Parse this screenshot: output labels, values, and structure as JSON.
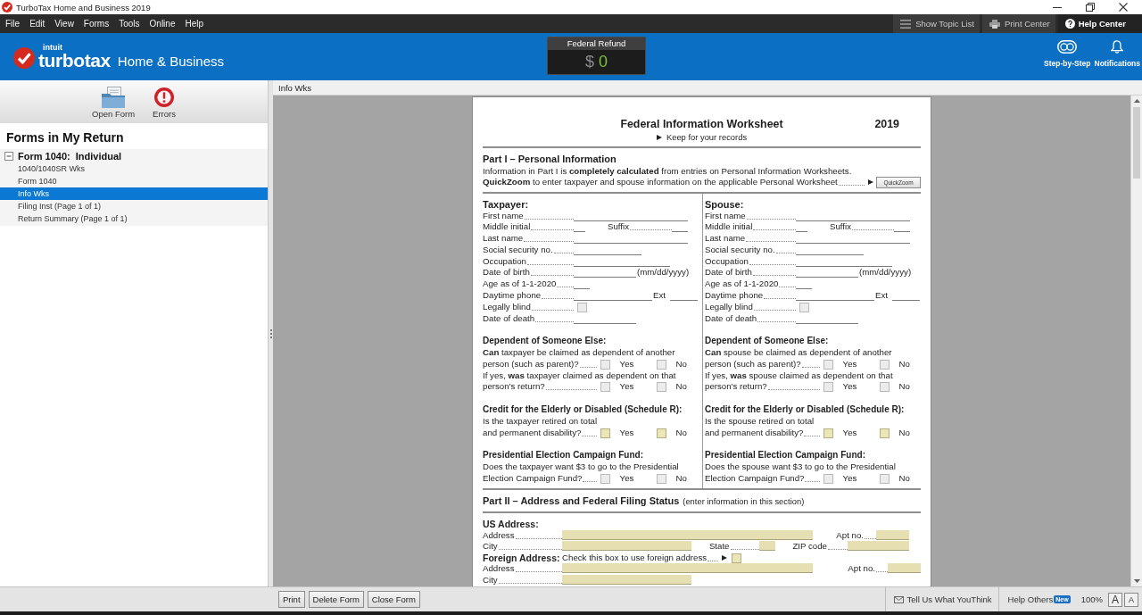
{
  "window": {
    "title": "TurboTax Home and Business 2019"
  },
  "menu": [
    "File",
    "Edit",
    "View",
    "Forms",
    "Tools",
    "Online",
    "Help"
  ],
  "toolbar_buttons": [
    {
      "label": "Show Topic List",
      "kind": "list"
    },
    {
      "label": "Print Center",
      "kind": "print"
    },
    {
      "label": "Help Center",
      "kind": "help"
    }
  ],
  "header": {
    "company": "intuit",
    "brand": "turbotax",
    "product": "Home & Business",
    "refund": {
      "label": "Federal Refund",
      "currency": "$",
      "amount": "0"
    },
    "actions": [
      {
        "label": "Step-by-Step",
        "kind": "steps"
      },
      {
        "label": "Notifications",
        "kind": "bell"
      }
    ]
  },
  "sidebar": {
    "tools": [
      {
        "label": "Open Form",
        "kind": "open"
      },
      {
        "label": "Errors",
        "kind": "errors"
      }
    ],
    "title": "Forms in My Return",
    "tree": [
      {
        "label": "Form 1040:  Individual",
        "expanded": true,
        "selected": false,
        "children": [
          {
            "label": "1040/1040SR Wks",
            "selected": false
          },
          {
            "label": "Form 1040",
            "selected": false
          },
          {
            "label": "Info Wks",
            "selected": true
          },
          {
            "label": "Filing Inst (Page 1 of 1)",
            "selected": false
          },
          {
            "label": "Return Summary (Page 1 of 1)",
            "selected": false
          }
        ]
      }
    ]
  },
  "document_tab": {
    "label": "Info Wks"
  },
  "form": {
    "title": "Federal Information Worksheet",
    "year": "2019",
    "subtitle": "Keep for your records",
    "part1": {
      "heading": "Part I – Personal Information",
      "intro": "Information in Part I is **completely calculated** from entries on Personal Information Worksheets.",
      "quickzoom_text": "**QuickZoom** to enter taxpayer and spouse information on the applicable Personal Worksheet",
      "quickzoom_button": "QuickZoom",
      "columns": [
        {
          "heading": "Taxpayer:",
          "fields": [
            {
              "kind": "name",
              "label": "First name"
            },
            {
              "kind": "initial",
              "label": "Middle initial",
              "extra_label": "Suffix"
            },
            {
              "kind": "name",
              "label": "Last name"
            },
            {
              "kind": "ssn",
              "label": "Social security no."
            },
            {
              "kind": "occupation",
              "label": "Occupation"
            },
            {
              "kind": "date",
              "label": "Date of birth",
              "hint": "(mm/dd/yyyy)"
            },
            {
              "kind": "age",
              "label": "Age as of 1-1-2020"
            },
            {
              "kind": "phone",
              "label": "Daytime phone",
              "extra_label": "Ext"
            },
            {
              "kind": "checkbox",
              "label": "Legally blind",
              "checked": false,
              "editable": false
            },
            {
              "kind": "date",
              "label": "Date of death"
            }
          ],
          "sections": [
            {
              "heading": "Dependent of Someone Else:",
              "questions": [
                {
                  "lines": [
                    "**Can** taxpayer be claimed as dependent of another",
                    "person (such as parent)?"
                  ],
                  "options": [
                    {
                      "label": "Yes",
                      "checked": false,
                      "editable": false
                    },
                    {
                      "label": "No",
                      "checked": false,
                      "editable": false
                    }
                  ]
                },
                {
                  "lines": [
                    "If yes, **was** taxpayer claimed as dependent on that",
                    "person's return?"
                  ],
                  "options": [
                    {
                      "label": "Yes",
                      "checked": false,
                      "editable": false
                    },
                    {
                      "label": "No",
                      "checked": false,
                      "editable": false
                    }
                  ]
                }
              ]
            },
            {
              "heading": "Credit for the Elderly or Disabled (Schedule R):",
              "questions": [
                {
                  "lines": [
                    "Is the taxpayer retired on total",
                    "and permanent disability?"
                  ],
                  "options": [
                    {
                      "label": "Yes",
                      "checked": false,
                      "editable": true
                    },
                    {
                      "label": "No",
                      "checked": false,
                      "editable": true
                    }
                  ]
                }
              ]
            },
            {
              "heading": "Presidential Election Campaign Fund:",
              "questions": [
                {
                  "lines": [
                    "Does the taxpayer want $3 to go to the Presidential",
                    "Election Campaign Fund?"
                  ],
                  "options": [
                    {
                      "label": "Yes",
                      "checked": false,
                      "editable": false
                    },
                    {
                      "label": "No",
                      "checked": false,
                      "editable": false
                    }
                  ]
                }
              ]
            }
          ]
        },
        {
          "heading": "Spouse:",
          "fields": [
            {
              "kind": "name",
              "label": "First name"
            },
            {
              "kind": "initial",
              "label": "Middle initial",
              "extra_label": "Suffix"
            },
            {
              "kind": "name",
              "label": "Last name"
            },
            {
              "kind": "ssn",
              "label": "Social security no."
            },
            {
              "kind": "occupation",
              "label": "Occupation"
            },
            {
              "kind": "date",
              "label": "Date of birth",
              "hint": "(mm/dd/yyyy)"
            },
            {
              "kind": "age",
              "label": "Age as of 1-1-2020"
            },
            {
              "kind": "phone",
              "label": "Daytime phone",
              "extra_label": "Ext"
            },
            {
              "kind": "checkbox",
              "label": "Legally blind",
              "checked": false,
              "editable": false
            },
            {
              "kind": "date",
              "label": "Date of death"
            }
          ],
          "sections": [
            {
              "heading": "Dependent of Someone Else:",
              "questions": [
                {
                  "lines": [
                    "**Can** spouse be claimed as dependent of another",
                    "person (such as parent)?"
                  ],
                  "options": [
                    {
                      "label": "Yes",
                      "checked": false,
                      "editable": false
                    },
                    {
                      "label": "No",
                      "checked": false,
                      "editable": false
                    }
                  ]
                },
                {
                  "lines": [
                    "If yes, **was** spouse claimed as dependent on that",
                    "person's return?"
                  ],
                  "options": [
                    {
                      "label": "Yes",
                      "checked": false,
                      "editable": false
                    },
                    {
                      "label": "No",
                      "checked": false,
                      "editable": false
                    }
                  ]
                }
              ]
            },
            {
              "heading": "Credit for the Elderly or Disabled (Schedule R):",
              "questions": [
                {
                  "lines": [
                    "Is the spouse retired on total",
                    "and permanent disability?"
                  ],
                  "options": [
                    {
                      "label": "Yes",
                      "checked": false,
                      "editable": true
                    },
                    {
                      "label": "No",
                      "checked": false,
                      "editable": true
                    }
                  ]
                }
              ]
            },
            {
              "heading": "Presidential Election Campaign Fund:",
              "questions": [
                {
                  "lines": [
                    "Does the spouse want $3 to go to the Presidential",
                    "Election Campaign Fund?"
                  ],
                  "options": [
                    {
                      "label": "Yes",
                      "checked": false,
                      "editable": false
                    },
                    {
                      "label": "No",
                      "checked": false,
                      "editable": false
                    }
                  ]
                }
              ]
            }
          ]
        }
      ]
    },
    "part2": {
      "heading": "Part II – Address and Federal Filing Status",
      "note": "(enter information in this section)",
      "us_address": {
        "heading": "US Address:",
        "rows": [
          [
            {
              "label": "Address",
              "kind": "street",
              "editable": true
            },
            {
              "label": "Apt no.",
              "kind": "apt",
              "editable": true
            }
          ],
          [
            {
              "label": "City",
              "kind": "city",
              "editable": true
            },
            {
              "label": "State",
              "kind": "state",
              "editable": true
            },
            {
              "label": "ZIP code",
              "kind": "zip",
              "editable": true
            }
          ]
        ]
      },
      "foreign_address": {
        "heading": "Foreign Address:",
        "check_label": "Check this box to use foreign address",
        "checked": false,
        "editable": true,
        "rows": [
          [
            {
              "label": "Address",
              "kind": "street",
              "editable": true
            },
            {
              "label": "Apt no.",
              "kind": "apt",
              "editable": true
            }
          ],
          [
            {
              "label": "City",
              "kind": "city",
              "editable": true
            }
          ]
        ]
      }
    }
  },
  "footer": {
    "buttons": [
      "Print",
      "Delete Form",
      "Close Form"
    ],
    "feedback": "Tell Us What YouThink",
    "help_others": {
      "label": "Help Others",
      "badge": "New"
    },
    "zoom": "100%",
    "text_size_buttons": [
      {
        "label": "A",
        "kind": "larger"
      },
      {
        "label": "A",
        "kind": "smaller"
      }
    ]
  }
}
